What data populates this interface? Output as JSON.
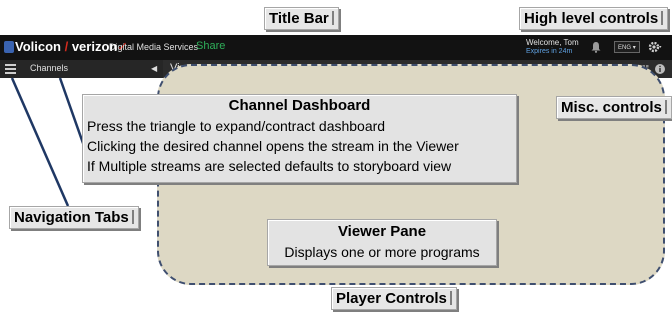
{
  "callouts": {
    "title_bar": "Title Bar",
    "high_level_controls": "High level controls",
    "misc_controls": "Misc. controls",
    "navigation_tabs": "Navigation Tabs",
    "player_controls": "Player Controls"
  },
  "app": {
    "logo_brand": "Volicon",
    "logo_partner": "verizon",
    "logo_division": "Digital Media Services",
    "share_label": "Share",
    "welcome_text": "Welcome, Tom",
    "expires_text": "Expires in 24m",
    "language": "ENG",
    "panel_title": "Channels",
    "viewer_title": "Viewer"
  },
  "channel_dashboard": {
    "title": "Channel Dashboard",
    "lines": [
      "Press the triangle to expand/contract dashboard",
      "Clicking the desired channel opens the stream in the Viewer",
      "If Multiple streams are selected defaults to storyboard view"
    ]
  },
  "viewer_pane": {
    "title": "Viewer Pane",
    "description": "Displays one or more programs"
  },
  "colors": {
    "title_bar_bg": "#121212",
    "toolbar_bg": "#2c2c2c",
    "share_green": "#2faf5a",
    "viewer_pane_fill": "#ddd8c4",
    "leader_line": "#1f3864"
  }
}
